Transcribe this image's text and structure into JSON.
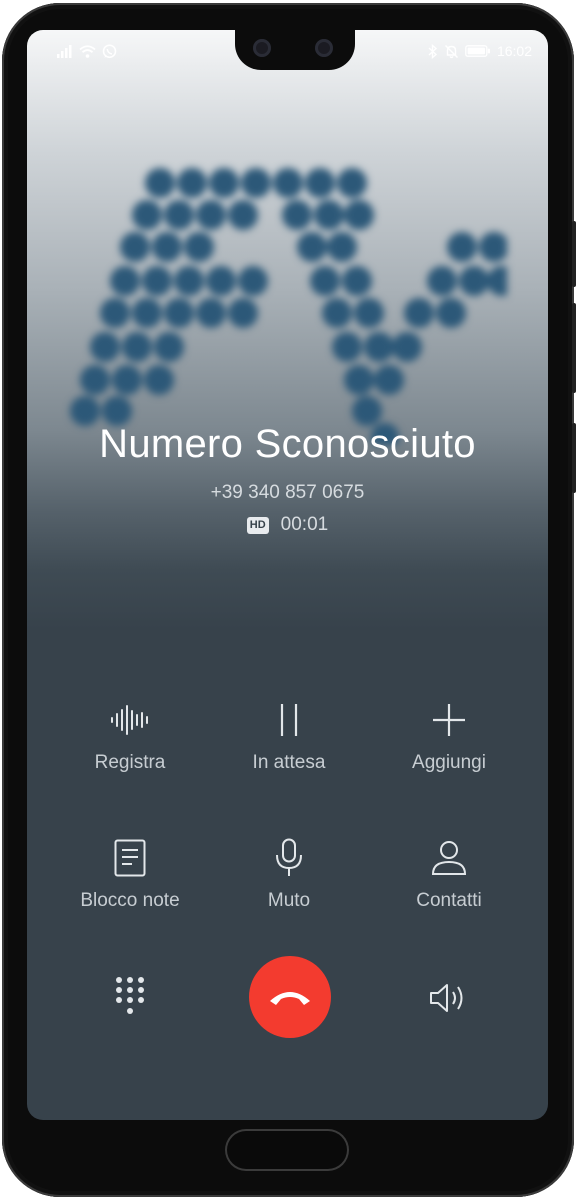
{
  "status_bar": {
    "time": "16:02",
    "left_icons": [
      "signal-icon",
      "wifi-icon",
      "whatsapp-icon"
    ],
    "right_icons": [
      "bluetooth-icon",
      "notifications-off-icon",
      "battery-icon"
    ]
  },
  "caller": {
    "name": "Numero Sconosciuto",
    "number": "+39 340 857 0675",
    "hd_badge": "HD",
    "duration": "00:01"
  },
  "actions": [
    {
      "label": "Registra",
      "icon": "record-icon"
    },
    {
      "label": "In attesa",
      "icon": "pause-icon"
    },
    {
      "label": "Aggiungi",
      "icon": "plus-icon"
    },
    {
      "label": "Blocco note",
      "icon": "notepad-icon"
    },
    {
      "label": "Muto",
      "icon": "microphone-icon"
    },
    {
      "label": "Contatti",
      "icon": "contact-icon"
    }
  ],
  "bottom_controls": {
    "dialpad_icon": "dialpad-icon",
    "end_call_icon": "hang-up-icon",
    "speaker_icon": "speaker-icon"
  },
  "colors": {
    "end_call": "#f33b2f",
    "background_dark": "#37424b",
    "logo_dots": "#2c5878"
  }
}
